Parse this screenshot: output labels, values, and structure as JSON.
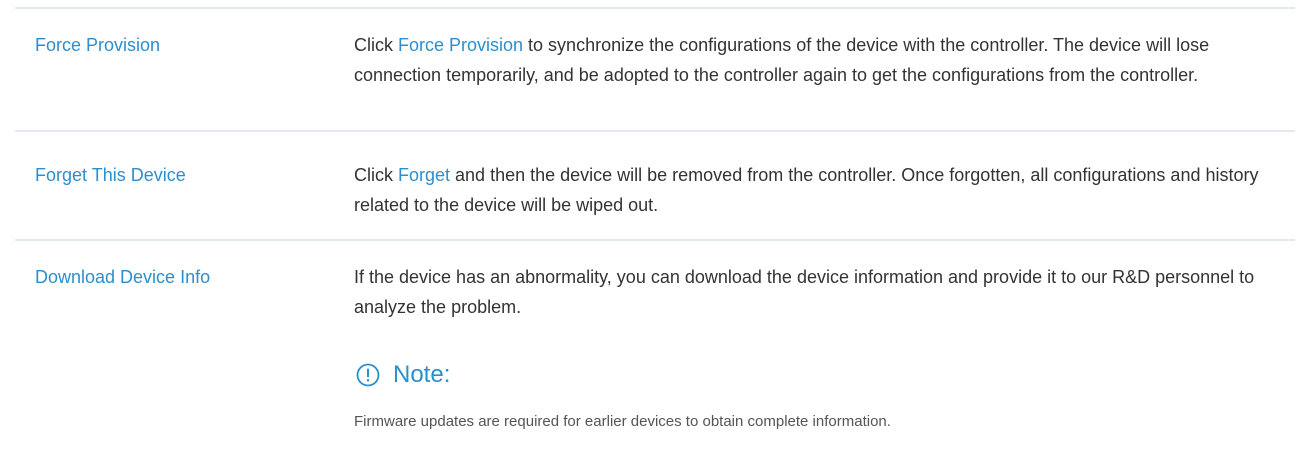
{
  "rows": [
    {
      "label": "Force Provision",
      "desc_before": "Click ",
      "desc_link": "Force Provision",
      "desc_after": " to synchronize the configurations of the device with the controller. The device will lose connection temporarily, and be adopted to the controller again to get the configurations from the controller."
    },
    {
      "label": "Forget This Device",
      "desc_before": "Click ",
      "desc_link": "Forget",
      "desc_after": " and then the device will be removed from the controller. Once forgotten, all configurations and history related to the device will be wiped out."
    },
    {
      "label": "Download Device Info",
      "desc": "If the device has an abnormality, you can download the device information and provide it to our R&D personnel to analyze the problem.",
      "note_title": "Note:",
      "note_text": "Firmware updates are required for earlier devices to obtain complete information."
    }
  ],
  "colors": {
    "accent": "#2b8fce",
    "text": "#333333",
    "divider": "#e3e8ee"
  },
  "icons": {
    "note": "exclamation-circle-icon"
  }
}
